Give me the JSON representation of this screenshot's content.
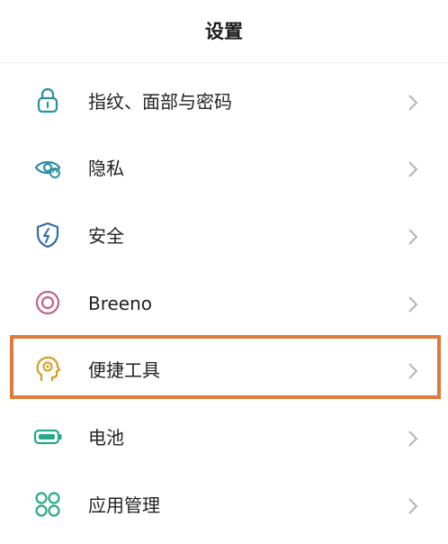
{
  "header": {
    "title": "设置"
  },
  "items": [
    {
      "label": "指纹、面部与密码",
      "icon": "lock-icon",
      "color": "#2b8fa3"
    },
    {
      "label": "隐私",
      "icon": "privacy-eye-icon",
      "color": "#2b8fa3"
    },
    {
      "label": "安全",
      "icon": "security-shield-icon",
      "color": "#2f6bb0"
    },
    {
      "label": "Breeno",
      "icon": "breeno-ring-icon",
      "color": "#c0608a"
    },
    {
      "label": "便捷工具",
      "icon": "convenience-tools-head-icon",
      "color": "#d99a1e"
    },
    {
      "label": "电池",
      "icon": "battery-icon",
      "color": "#26a88a"
    },
    {
      "label": "应用管理",
      "icon": "app-management-grid-icon",
      "color": "#26a88a"
    }
  ],
  "highlight": {
    "target": "便捷工具",
    "color": "#e07a3a"
  }
}
